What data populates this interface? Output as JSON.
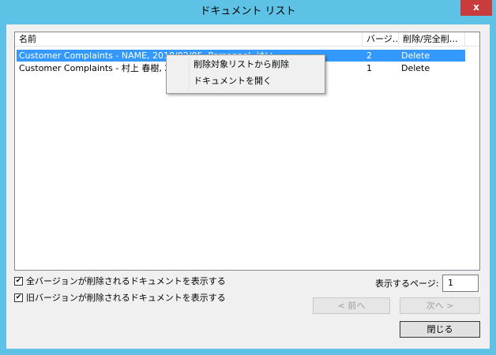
{
  "window": {
    "title": "ドキュメント リスト",
    "close_glyph": "x"
  },
  "list": {
    "columns": [
      "名前",
      "バージ…",
      "削除/完全削…"
    ],
    "rows": [
      {
        "name": "Customer Complaints - NAME, 2018/02/05, Personnel, はい",
        "version": "2",
        "action": "Delete",
        "selected": true
      },
      {
        "name": "Customer Complaints - 村上 春樹, 2018/01/24, Personnel, はい",
        "version": "1",
        "action": "Delete",
        "selected": false
      }
    ]
  },
  "context_menu": {
    "items": [
      "削除対象リストから削除",
      "ドキュメントを開く"
    ]
  },
  "options": {
    "show_all_versions": {
      "label": "全バージョンが削除されるドキュメントを表示する",
      "checked": true
    },
    "show_old_versions": {
      "label": "旧バージョンが削除されるドキュメントを表示する",
      "checked": true
    }
  },
  "paging": {
    "label": "表示するページ:",
    "value": "1",
    "prev_label": "< 前へ",
    "next_label": "次へ >"
  },
  "footer": {
    "close_label": "閉じる"
  },
  "colors": {
    "title_bar": "#5ec1e6",
    "close_button": "#c83c3c",
    "selection": "#3399ff"
  }
}
